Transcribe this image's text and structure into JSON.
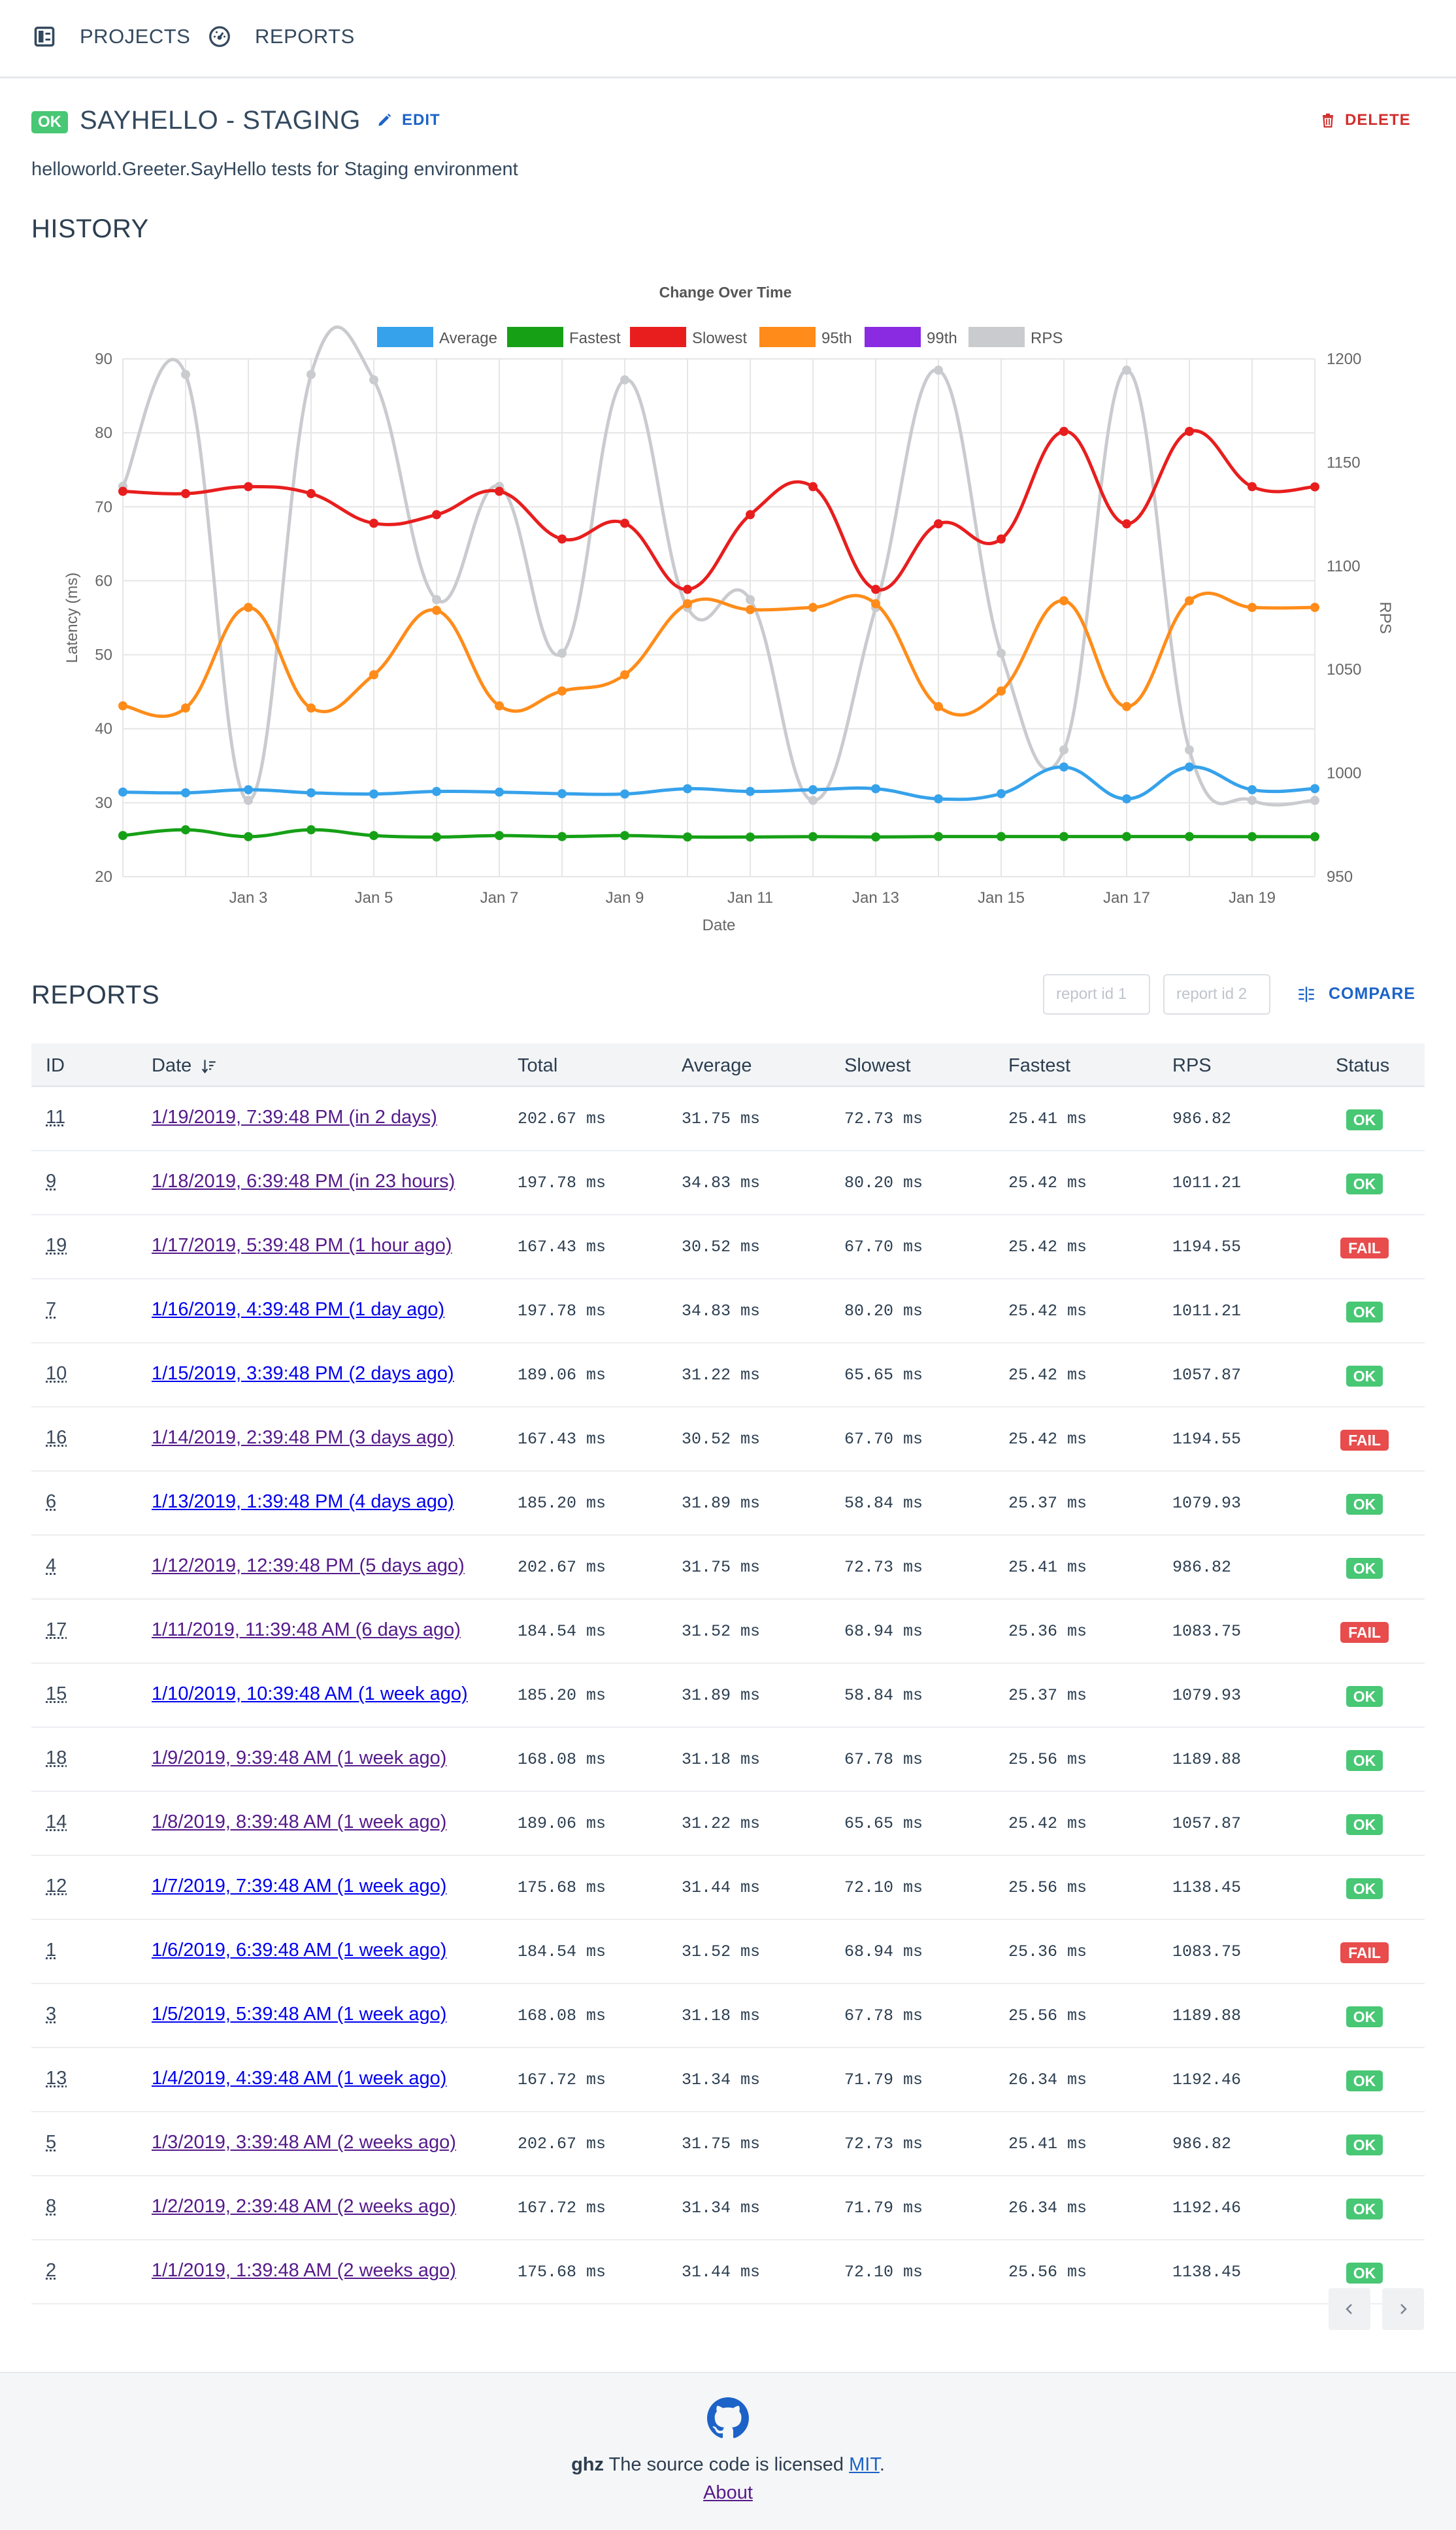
{
  "nav": {
    "projects_label": "PROJECTS",
    "reports_label": "REPORTS"
  },
  "project": {
    "status": "OK",
    "title": "SAYHELLO - STAGING",
    "edit_label": "EDIT",
    "delete_label": "DELETE",
    "description": "helloworld.Greeter.SayHello tests for Staging environment"
  },
  "history": {
    "title": "HISTORY"
  },
  "chart_data": {
    "type": "line",
    "title": "Change Over Time",
    "xlabel": "Date",
    "ylabel": "Latency (ms)",
    "y2label": "RPS",
    "ylim": [
      20,
      90
    ],
    "y2lim": [
      950,
      1200
    ],
    "yticks": [
      "90",
      "80",
      "70",
      "60",
      "50",
      "40",
      "30",
      "20"
    ],
    "y2ticks": [
      "1200",
      "1150",
      "1100",
      "1050",
      "1000",
      "950"
    ],
    "xticks": [
      "Jan 3",
      "Jan 5",
      "Jan 7",
      "Jan 9",
      "Jan 11",
      "Jan 13",
      "Jan 15",
      "Jan 17",
      "Jan 19"
    ],
    "grid": true,
    "legend_position": "top",
    "x": [
      "2019-01-01",
      "2019-01-02",
      "2019-01-03",
      "2019-01-04",
      "2019-01-05",
      "2019-01-06",
      "2019-01-07",
      "2019-01-08",
      "2019-01-09",
      "2019-01-10",
      "2019-01-11",
      "2019-01-12",
      "2019-01-13",
      "2019-01-14",
      "2019-01-15",
      "2019-01-16",
      "2019-01-17",
      "2019-01-18",
      "2019-01-19",
      "2019-01-20"
    ],
    "series": [
      {
        "name": "Average",
        "axis": "left",
        "color": "#36a2eb",
        "values": [
          31.44,
          31.34,
          31.75,
          31.34,
          31.18,
          31.52,
          31.44,
          31.22,
          31.18,
          31.89,
          31.52,
          31.75,
          31.89,
          30.52,
          31.22,
          34.83,
          30.52,
          34.83,
          31.75,
          31.9
        ]
      },
      {
        "name": "Fastest",
        "axis": "left",
        "color": "#16a016",
        "values": [
          25.56,
          26.34,
          25.41,
          26.34,
          25.56,
          25.36,
          25.56,
          25.42,
          25.56,
          25.37,
          25.36,
          25.41,
          25.37,
          25.42,
          25.42,
          25.42,
          25.42,
          25.42,
          25.41,
          25.4
        ]
      },
      {
        "name": "Slowest",
        "axis": "left",
        "color": "#e81e1e",
        "values": [
          72.1,
          71.79,
          72.73,
          71.79,
          67.78,
          68.94,
          72.1,
          65.65,
          67.78,
          58.84,
          68.94,
          72.73,
          58.84,
          67.7,
          65.65,
          80.2,
          67.7,
          80.2,
          72.73,
          72.7
        ]
      },
      {
        "name": "95th",
        "axis": "left",
        "color": "#ff8c1a",
        "values": [
          43.1,
          42.8,
          56.4,
          42.8,
          47.3,
          56.0,
          43.1,
          45.1,
          47.3,
          56.9,
          56.1,
          56.4,
          56.9,
          43.0,
          45.1,
          57.3,
          43.0,
          57.3,
          56.4,
          56.4
        ]
      },
      {
        "name": "99th",
        "axis": "left",
        "color": "#8a2be2",
        "values": []
      },
      {
        "name": "RPS",
        "axis": "right",
        "color": "#c9cbcf",
        "values": [
          1138.45,
          1192.46,
          986.82,
          1192.46,
          1189.88,
          1083.75,
          1138.45,
          1057.87,
          1189.88,
          1079.93,
          1083.75,
          986.82,
          1079.93,
          1194.55,
          1057.87,
          1011.21,
          1194.55,
          1011.21,
          986.82,
          986.8
        ]
      }
    ]
  },
  "reports": {
    "title": "REPORTS",
    "report_id1_placeholder": "report id 1",
    "report_id2_placeholder": "report id 2",
    "compare_label": "COMPARE",
    "columns": [
      "ID",
      "Date",
      "Total",
      "Average",
      "Slowest",
      "Fastest",
      "RPS",
      "Status"
    ],
    "rows": [
      {
        "id": "11",
        "date": "1/19/2019, 7:39:48 PM (in 2 days)",
        "total": "202.67 ms",
        "average": "31.75 ms",
        "slowest": "72.73 ms",
        "fastest": "25.41 ms",
        "rps": "986.82",
        "status": "OK",
        "visited": true
      },
      {
        "id": "9",
        "date": "1/18/2019, 6:39:48 PM (in 23 hours)",
        "total": "197.78 ms",
        "average": "34.83 ms",
        "slowest": "80.20 ms",
        "fastest": "25.42 ms",
        "rps": "1011.21",
        "status": "OK",
        "visited": true
      },
      {
        "id": "19",
        "date": "1/17/2019, 5:39:48 PM (1 hour ago)",
        "total": "167.43 ms",
        "average": "30.52 ms",
        "slowest": "67.70 ms",
        "fastest": "25.42 ms",
        "rps": "1194.55",
        "status": "FAIL",
        "visited": true
      },
      {
        "id": "7",
        "date": "1/16/2019, 4:39:48 PM (1 day ago)",
        "total": "197.78 ms",
        "average": "34.83 ms",
        "slowest": "80.20 ms",
        "fastest": "25.42 ms",
        "rps": "1011.21",
        "status": "OK",
        "visited": false
      },
      {
        "id": "10",
        "date": "1/15/2019, 3:39:48 PM (2 days ago)",
        "total": "189.06 ms",
        "average": "31.22 ms",
        "slowest": "65.65 ms",
        "fastest": "25.42 ms",
        "rps": "1057.87",
        "status": "OK",
        "visited": false
      },
      {
        "id": "16",
        "date": "1/14/2019, 2:39:48 PM (3 days ago)",
        "total": "167.43 ms",
        "average": "30.52 ms",
        "slowest": "67.70 ms",
        "fastest": "25.42 ms",
        "rps": "1194.55",
        "status": "FAIL",
        "visited": true
      },
      {
        "id": "6",
        "date": "1/13/2019, 1:39:48 PM (4 days ago)",
        "total": "185.20 ms",
        "average": "31.89 ms",
        "slowest": "58.84 ms",
        "fastest": "25.37 ms",
        "rps": "1079.93",
        "status": "OK",
        "visited": false
      },
      {
        "id": "4",
        "date": "1/12/2019, 12:39:48 PM (5 days ago)",
        "total": "202.67 ms",
        "average": "31.75 ms",
        "slowest": "72.73 ms",
        "fastest": "25.41 ms",
        "rps": "986.82",
        "status": "OK",
        "visited": true
      },
      {
        "id": "17",
        "date": "1/11/2019, 11:39:48 AM (6 days ago)",
        "total": "184.54 ms",
        "average": "31.52 ms",
        "slowest": "68.94 ms",
        "fastest": "25.36 ms",
        "rps": "1083.75",
        "status": "FAIL",
        "visited": true
      },
      {
        "id": "15",
        "date": "1/10/2019, 10:39:48 AM (1 week ago)",
        "total": "185.20 ms",
        "average": "31.89 ms",
        "slowest": "58.84 ms",
        "fastest": "25.37 ms",
        "rps": "1079.93",
        "status": "OK",
        "visited": false
      },
      {
        "id": "18",
        "date": "1/9/2019, 9:39:48 AM (1 week ago)",
        "total": "168.08 ms",
        "average": "31.18 ms",
        "slowest": "67.78 ms",
        "fastest": "25.56 ms",
        "rps": "1189.88",
        "status": "OK",
        "visited": true
      },
      {
        "id": "14",
        "date": "1/8/2019, 8:39:48 AM (1 week ago)",
        "total": "189.06 ms",
        "average": "31.22 ms",
        "slowest": "65.65 ms",
        "fastest": "25.42 ms",
        "rps": "1057.87",
        "status": "OK",
        "visited": true
      },
      {
        "id": "12",
        "date": "1/7/2019, 7:39:48 AM (1 week ago)",
        "total": "175.68 ms",
        "average": "31.44 ms",
        "slowest": "72.10 ms",
        "fastest": "25.56 ms",
        "rps": "1138.45",
        "status": "OK",
        "visited": false
      },
      {
        "id": "1",
        "date": "1/6/2019, 6:39:48 AM (1 week ago)",
        "total": "184.54 ms",
        "average": "31.52 ms",
        "slowest": "68.94 ms",
        "fastest": "25.36 ms",
        "rps": "1083.75",
        "status": "FAIL",
        "visited": false
      },
      {
        "id": "3",
        "date": "1/5/2019, 5:39:48 AM (1 week ago)",
        "total": "168.08 ms",
        "average": "31.18 ms",
        "slowest": "67.78 ms",
        "fastest": "25.56 ms",
        "rps": "1189.88",
        "status": "OK",
        "visited": false
      },
      {
        "id": "13",
        "date": "1/4/2019, 4:39:48 AM (1 week ago)",
        "total": "167.72 ms",
        "average": "31.34 ms",
        "slowest": "71.79 ms",
        "fastest": "26.34 ms",
        "rps": "1192.46",
        "status": "OK",
        "visited": false
      },
      {
        "id": "5",
        "date": "1/3/2019, 3:39:48 AM (2 weeks ago)",
        "total": "202.67 ms",
        "average": "31.75 ms",
        "slowest": "72.73 ms",
        "fastest": "25.41 ms",
        "rps": "986.82",
        "status": "OK",
        "visited": true
      },
      {
        "id": "8",
        "date": "1/2/2019, 2:39:48 AM (2 weeks ago)",
        "total": "167.72 ms",
        "average": "31.34 ms",
        "slowest": "71.79 ms",
        "fastest": "26.34 ms",
        "rps": "1192.46",
        "status": "OK",
        "visited": true
      },
      {
        "id": "2",
        "date": "1/1/2019, 1:39:48 AM (2 weeks ago)",
        "total": "175.68 ms",
        "average": "31.44 ms",
        "slowest": "72.10 ms",
        "fastest": "25.56 ms",
        "rps": "1138.45",
        "status": "OK",
        "visited": true
      }
    ]
  },
  "footer": {
    "brand": "ghz",
    "text": "The source code is licensed",
    "license": "MIT",
    "period": ".",
    "about": "About"
  },
  "colors": {
    "ok": "#48c774",
    "fail": "#e84c4c",
    "link": "#1c63c8",
    "danger": "#d22e2e"
  }
}
